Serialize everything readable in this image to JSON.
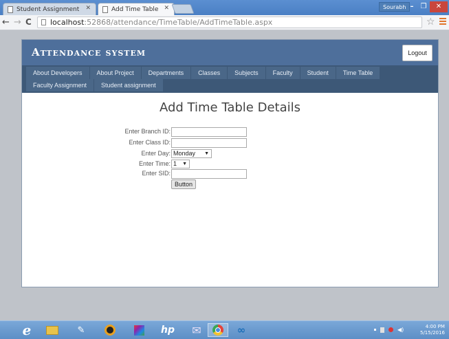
{
  "browser": {
    "tabs": [
      {
        "label": "Student Assignment",
        "active": false
      },
      {
        "label": "Add Time Table",
        "active": true
      }
    ],
    "user": "Sourabh",
    "url_host": "localhost",
    "url_rest": ":52868/attendance/TimeTable/AddTimeTable.aspx"
  },
  "header": {
    "brand": "Attendance system",
    "logout_label": "Logout"
  },
  "nav": {
    "row1": [
      "About Developers",
      "About Project",
      "Departments",
      "Classes",
      "Subjects",
      "Faculty",
      "Student",
      "Time Table"
    ],
    "row2": [
      "Faculty Assignment",
      "Student assignment"
    ]
  },
  "form": {
    "title": "Add Time Table Details",
    "branch_label": "Enter Branch ID:",
    "branch_value": "",
    "class_label": "Enter Class ID:",
    "class_value": "",
    "day_label": "Enter Day:",
    "day_value": "Monday",
    "time_label": "Enter Time:",
    "time_value": "1",
    "sid_label": "Enter SID:",
    "sid_value": "",
    "submit_label": "Button"
  },
  "taskbar": {
    "time": "4:00 PM",
    "date": "5/15/2016",
    "colors": {
      "ie": "#2c8fd8",
      "explorer": "#e9c34b",
      "chrome": "#e3433a",
      "hp": "#1d6fb8"
    }
  }
}
